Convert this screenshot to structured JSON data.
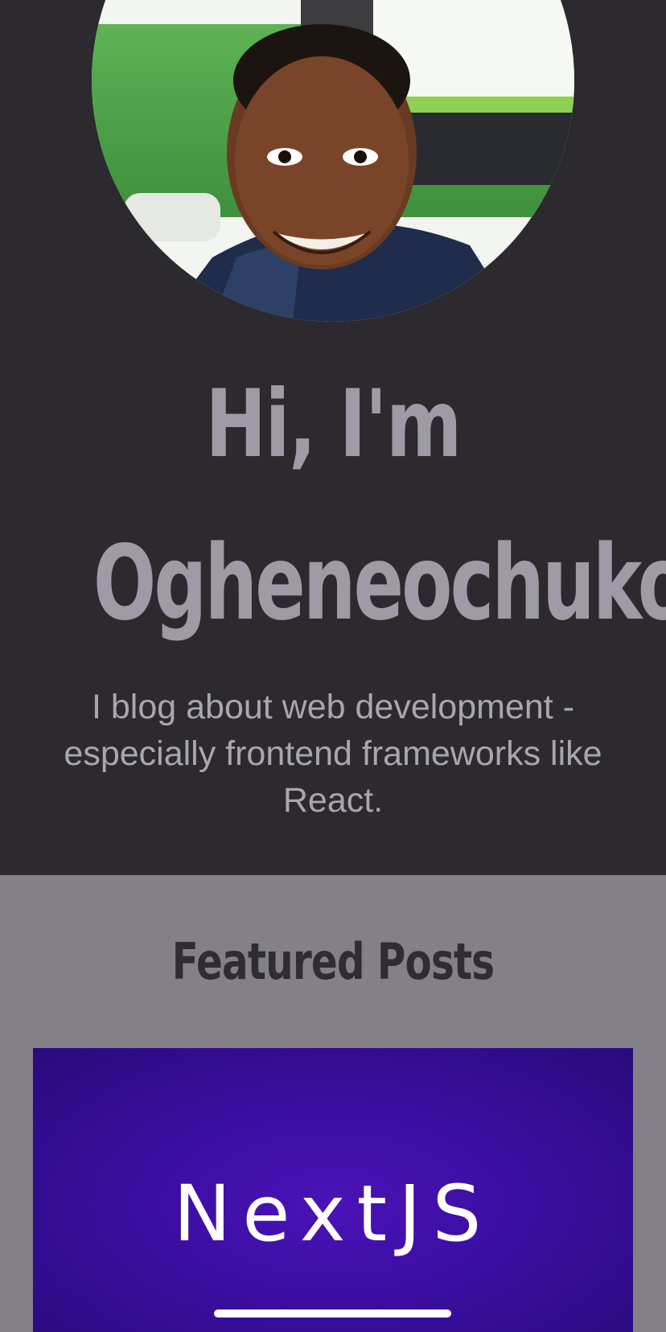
{
  "hero": {
    "avatar_alt": "profile photo",
    "title_line1": "Hi, I'm",
    "title_line2": "Ogheneochuko",
    "subtitle": "I blog about web development - especially frontend frameworks like React."
  },
  "featured": {
    "heading": "Featured Posts",
    "posts": [
      {
        "title": "NextJS"
      }
    ]
  },
  "colors": {
    "hero_background": "#2c292f",
    "title_text": "#9e9ba6",
    "featured_background": "#838088",
    "card_purple": "#3a0ea0"
  }
}
